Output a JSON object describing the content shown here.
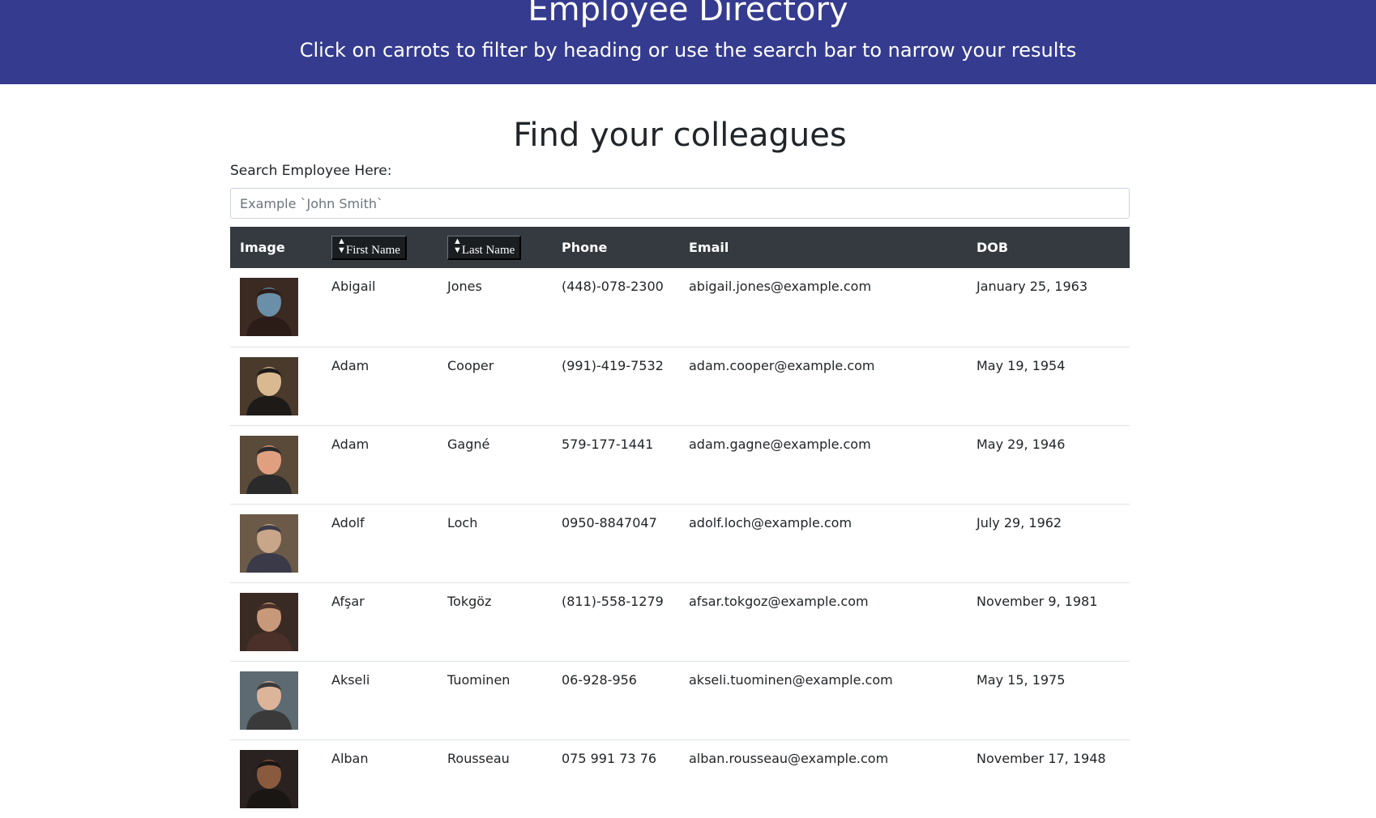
{
  "header": {
    "title": "Employee Directory",
    "subtitle": "Click on carrots to filter by heading or use the search bar to narrow your results"
  },
  "main": {
    "heading": "Find your colleagues",
    "search_label": "Search Employee Here:",
    "search_placeholder": "Example `John Smith`"
  },
  "table": {
    "columns": {
      "image": "Image",
      "first_name": "First Name",
      "last_name": "Last Name",
      "phone": "Phone",
      "email": "Email",
      "dob": "DOB"
    },
    "sort_icon": "sort-up-down-icon",
    "rows": [
      {
        "first": "Abigail",
        "last": "Jones",
        "phone": "(448)-078-2300",
        "email": "abigail.jones@example.com",
        "dob": "January 25, 1963"
      },
      {
        "first": "Adam",
        "last": "Cooper",
        "phone": "(991)-419-7532",
        "email": "adam.cooper@example.com",
        "dob": "May 19, 1954"
      },
      {
        "first": "Adam",
        "last": "Gagné",
        "phone": "579-177-1441",
        "email": "adam.gagne@example.com",
        "dob": "May 29, 1946"
      },
      {
        "first": "Adolf",
        "last": "Loch",
        "phone": "0950-8847047",
        "email": "adolf.loch@example.com",
        "dob": "July 29, 1962"
      },
      {
        "first": "Afşar",
        "last": "Tokgöz",
        "phone": "(811)-558-1279",
        "email": "afsar.tokgoz@example.com",
        "dob": "November 9, 1981"
      },
      {
        "first": "Akseli",
        "last": "Tuominen",
        "phone": "06-928-956",
        "email": "akseli.tuominen@example.com",
        "dob": "May 15, 1975"
      },
      {
        "first": "Alban",
        "last": "Rousseau",
        "phone": "075 991 73 76",
        "email": "alban.rousseau@example.com",
        "dob": "November 17, 1948"
      }
    ]
  },
  "colors": {
    "header_bg": "#353b8f",
    "table_head_bg": "#343a40"
  }
}
